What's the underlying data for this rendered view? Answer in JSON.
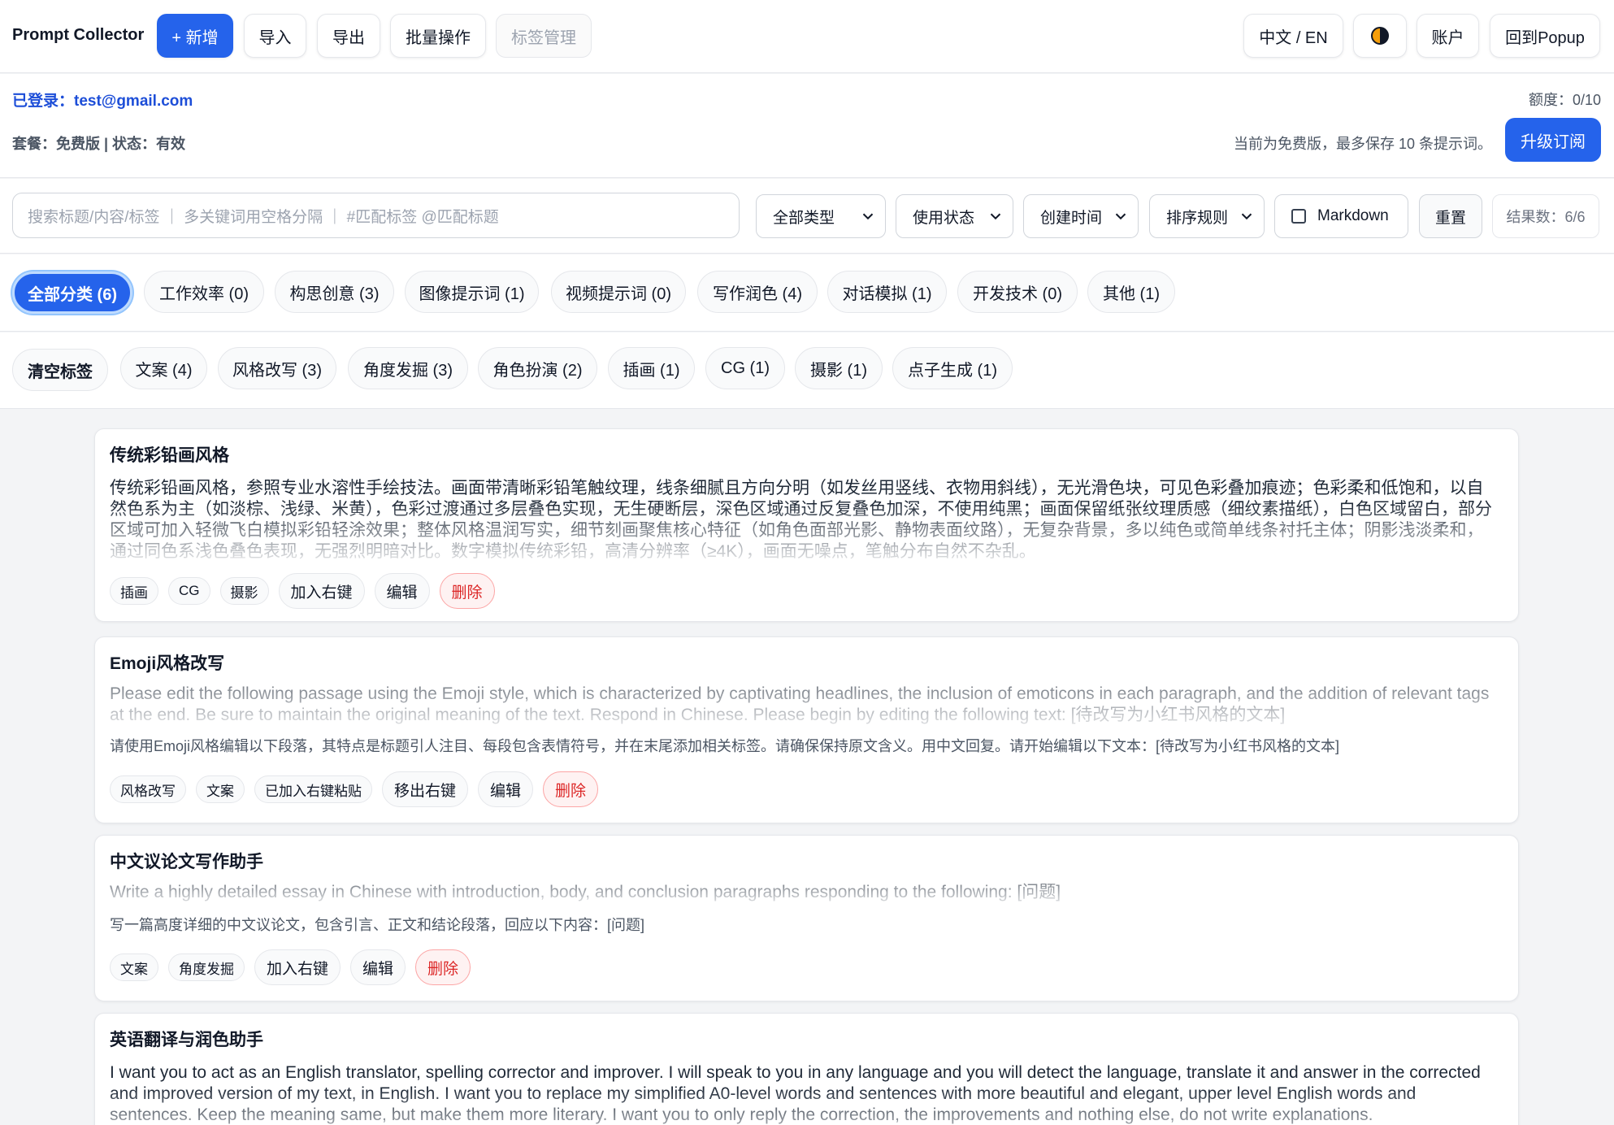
{
  "header": {
    "app_title": "Prompt Collector",
    "new_label": "+ 新增",
    "import_label": "导入",
    "export_label": "导出",
    "batch_label": "批量操作",
    "tags_label": "标签管理",
    "lang_label": "中文 / EN",
    "account_label": "账户",
    "back_label": "回到Popup"
  },
  "account": {
    "logged_in": "已登录：test@gmail.com",
    "plan_status": "套餐：免费版 | 状态：有效",
    "quota": "额度：0/10",
    "notice": "当前为免费版，最多保存 10 条提示词。",
    "upgrade_label": "升级订阅"
  },
  "filters": {
    "search_placeholder": "搜索标题/内容/标签 ｜ 多关键词用空格分隔 ｜ #匹配标签 @匹配标题",
    "type_select": "全部类型",
    "usage_select": "使用状态",
    "time_select": "创建时间",
    "sort_select": "排序规则",
    "markdown_label": "Markdown",
    "reset_label": "重置",
    "result_count": "结果数：6/6"
  },
  "categories": [
    "全部分类 (6)",
    "工作效率 (0)",
    "构思创意 (3)",
    "图像提示词 (1)",
    "视频提示词 (0)",
    "写作润色 (4)",
    "对话模拟 (1)",
    "开发技术 (0)",
    "其他 (1)"
  ],
  "tag_filters": [
    "清空标签",
    "文案 (4)",
    "风格改写 (3)",
    "角度发掘 (3)",
    "角色扮演 (2)",
    "插画 (1)",
    "CG (1)",
    "摄影 (1)",
    "点子生成 (1)"
  ],
  "cards": [
    {
      "title": "传统彩铅画风格",
      "body": "传统彩铅画风格，参照专业水溶性手绘技法。画面带清晰彩铅笔触纹理，线条细腻且方向分明（如发丝用竖线、衣物用斜线），无光滑色块，可见色彩叠加痕迹；色彩柔和低饱和，以自然色系为主（如淡棕、浅绿、米黄），色彩过渡通过多层叠色实现，无生硬断层，深色区域通过反复叠色加深，不使用纯黑；画面保留纸张纹理质感（细纹素描纸），白色区域留白，部分区域可加入轻微飞白模拟彩铅轻涂效果；整体风格温润写实，细节刻画聚焦核心特征（如角色面部光影、静物表面纹路），无复杂背景，多以纯色或简单线条衬托主体；阴影浅淡柔和，通过同色系浅色叠色表现，无强烈明暗对比。数字模拟传统彩铅，高清分辨率（≥4K），画面无噪点，笔触分布自然不杂乱。",
      "tags": [
        "插画",
        "CG",
        "摄影"
      ],
      "actions": [
        "加入右键",
        "编辑",
        "删除"
      ]
    },
    {
      "title": "Emoji风格改写",
      "body": "Please edit the following passage using the Emoji style, which is characterized by captivating headlines, the inclusion of emoticons in each paragraph, and the addition of relevant tags at the end. Be sure to maintain the original meaning of the text. Respond in Chinese. Please begin by editing the following text: [待改写为小红书风格的文本]",
      "translation": "请使用Emoji风格编辑以下段落，其特点是标题引人注目、每段包含表情符号，并在末尾添加相关标签。请确保保持原文含义。用中文回复。请开始编辑以下文本：[待改写为小红书风格的文本]",
      "tags": [
        "风格改写",
        "文案",
        "已加入右键粘贴"
      ],
      "actions": [
        "移出右键",
        "编辑",
        "删除"
      ]
    },
    {
      "title": "中文议论文写作助手",
      "body": "Write a highly detailed essay in Chinese with introduction, body, and conclusion paragraphs responding to the following: [问题]",
      "translation": "写一篇高度详细的中文议论文，包含引言、正文和结论段落，回应以下内容：[问题]",
      "tags": [
        "文案",
        "角度发掘"
      ],
      "actions": [
        "加入右键",
        "编辑",
        "删除"
      ]
    },
    {
      "title": "英语翻译与润色助手",
      "body": "I want you to act as an English translator, spelling corrector and improver. I will speak to you in any language and you will detect the language, translate it and answer in the corrected and improved version of my text, in English. I want you to replace my simplified A0-level words and sentences with more beautiful and elegant, upper level English words and sentences. Keep the meaning same, but make them more literary. I want you to only reply the correction, the improvements and nothing else, do not write explanations."
    }
  ],
  "colors": {
    "primary": "#2563eb",
    "danger": "#dc2626",
    "logged_in": "#1d4ed8"
  }
}
